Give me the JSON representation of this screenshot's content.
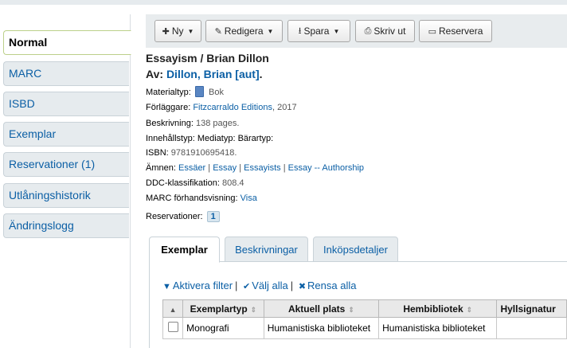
{
  "sidebar": {
    "items": [
      {
        "label": "Normal"
      },
      {
        "label": "MARC"
      },
      {
        "label": "ISBD"
      },
      {
        "label": "Exemplar"
      },
      {
        "label": "Reservationer (1)"
      },
      {
        "label": "Utlåningshistorik"
      },
      {
        "label": "Ändringslogg"
      }
    ]
  },
  "toolbar": {
    "new_label": "Ny",
    "edit_label": "Redigera",
    "save_label": "Spara",
    "print_label": "Skriv ut",
    "reserve_label": "Reservera"
  },
  "record": {
    "title": "Essayism / Brian Dillon",
    "author_prefix": "Av: ",
    "author": "Dillon, Brian [aut]",
    "author_suffix": ".",
    "material_label": "Materialtyp:",
    "material_value": "Bok",
    "publisher_label": "Förläggare:",
    "publisher_value": "Fitzcarraldo Editions",
    "publisher_year": ", 2017",
    "description_label": "Beskrivning:",
    "description_value": "138 pages.",
    "content_label": "Innehållstyp: Mediatyp: Bärartyp:",
    "isbn_label": "ISBN:",
    "isbn_value": "9781910695418.",
    "subjects_label": "Ämnen:",
    "subjects": [
      "Essäer",
      "Essay",
      "Essayists",
      "Essay -- Authorship"
    ],
    "ddc_label": "DDC-klassifikation:",
    "ddc_value": "808.4",
    "marc_label": "MARC förhandsvisning:",
    "marc_link": "Visa",
    "holds_label": "Reservationer:",
    "holds_count": "1"
  },
  "tabs": [
    {
      "label": "Exemplar"
    },
    {
      "label": "Beskrivningar"
    },
    {
      "label": "Inköpsdetaljer"
    }
  ],
  "filters": {
    "activate": "Aktivera filter",
    "select_all": "Välj alla",
    "clear_all": "Rensa alla"
  },
  "table": {
    "columns": [
      "Exemplartyp",
      "Aktuell plats",
      "Hembibliotek",
      "Hyllsignatur"
    ],
    "rows": [
      {
        "type": "Monografi",
        "current": "Humanistiska biblioteket",
        "home": "Humanistiska biblioteket",
        "callnumber": ""
      }
    ]
  },
  "colors": {
    "link": "#0b5fa5",
    "tab_bg": "#e6ebee",
    "active_border": "#bcd08a"
  }
}
